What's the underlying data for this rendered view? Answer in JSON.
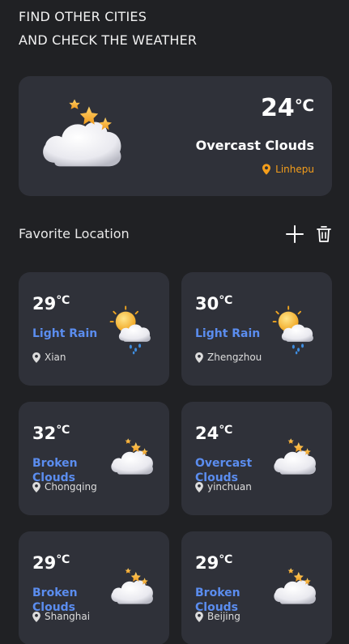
{
  "header": {
    "line1": "FIND OTHER CITIES",
    "line2": "AND CHECK THE WEATHER"
  },
  "current": {
    "temp": "24",
    "unit": "℃",
    "description": "Overcast Clouds",
    "location": "Linhepu",
    "icon": "cloud-stars-icon"
  },
  "favorites": {
    "title": "Favorite Location",
    "add_icon": "plus-icon",
    "delete_icon": "trash-icon",
    "items": [
      {
        "temp": "29",
        "unit": "℃",
        "description": "Light Rain",
        "location": "Xian",
        "icon": "sun-rain-cloud-icon"
      },
      {
        "temp": "30",
        "unit": "℃",
        "description": "Light Rain",
        "location": "Zhengzhou",
        "icon": "sun-rain-cloud-icon"
      },
      {
        "temp": "32",
        "unit": "℃",
        "description": "Broken Clouds",
        "location": "Chongqing",
        "icon": "cloud-stars-icon"
      },
      {
        "temp": "24",
        "unit": "℃",
        "description": "Overcast Clouds",
        "location": "yinchuan",
        "icon": "cloud-stars-icon"
      },
      {
        "temp": "29",
        "unit": "℃",
        "description": "Broken Clouds",
        "location": "Shanghai",
        "icon": "cloud-stars-icon"
      },
      {
        "temp": "29",
        "unit": "℃",
        "description": "Broken Clouds",
        "location": "Beijing",
        "icon": "cloud-stars-icon"
      }
    ]
  },
  "colors": {
    "background": "#202124",
    "card": "#2f3139",
    "accent_blue": "#5b8def",
    "accent_orange": "#f59e1b"
  }
}
